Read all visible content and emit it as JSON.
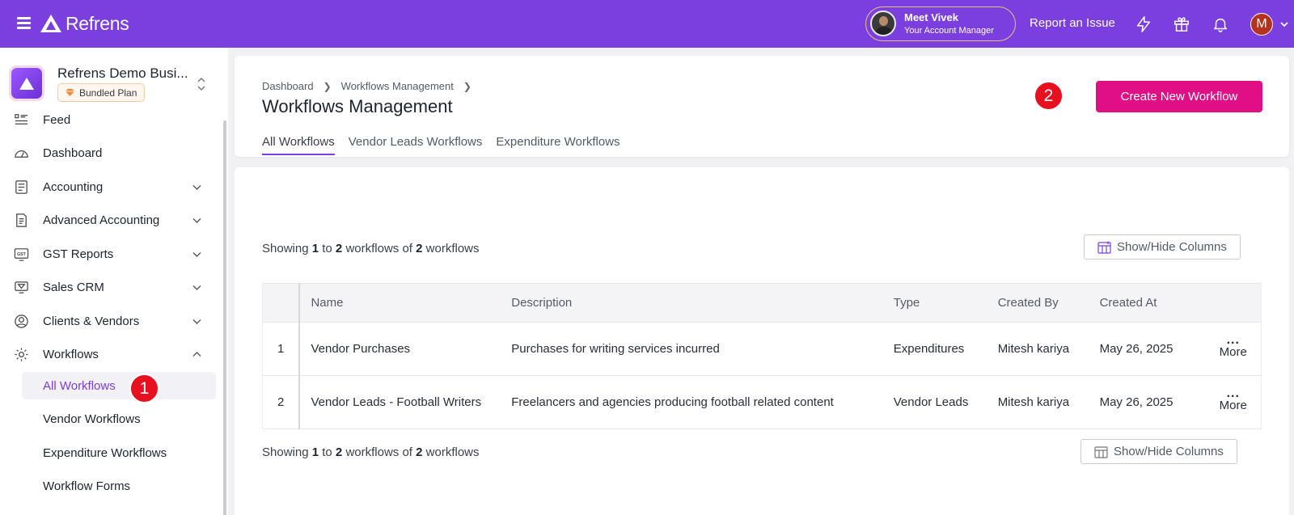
{
  "topbar": {
    "brand": "Refrens",
    "account_manager": {
      "name": "Meet Vivek",
      "subtitle": "Your Account Manager"
    },
    "report_issue": "Report an Issue",
    "user_initial": "M",
    "icons": [
      "menu-icon",
      "bolt-icon",
      "gift-icon",
      "bell-icon",
      "chevron-down-icon"
    ],
    "accent": "#7b3fe0"
  },
  "sidebar": {
    "business_name": "Refrens Demo Busi...",
    "plan": "Bundled Plan",
    "items": [
      {
        "label": "Feed",
        "icon": "feed-icon"
      },
      {
        "label": "Dashboard",
        "icon": "dashboard-icon"
      },
      {
        "label": "Accounting",
        "icon": "ledger-icon"
      },
      {
        "label": "Advanced Accounting",
        "icon": "document-icon"
      },
      {
        "label": "GST Reports",
        "icon": "gst-icon"
      },
      {
        "label": "Sales CRM",
        "icon": "crm-icon"
      },
      {
        "label": "Clients & Vendors",
        "icon": "user-circle-icon"
      },
      {
        "label": "Workflows",
        "icon": "workflow-gear-icon"
      }
    ],
    "subitems": [
      {
        "label": "All Workflows",
        "active": true
      },
      {
        "label": "Vendor Workflows"
      },
      {
        "label": "Expenditure Workflows"
      },
      {
        "label": "Workflow Forms"
      }
    ],
    "marker_1": "1"
  },
  "header": {
    "breadcrumbs": [
      "Dashboard",
      "Workflows Management"
    ],
    "title": "Workflows Management",
    "tabs": [
      "All Workflows",
      "Vendor Leads Workflows",
      "Expenditure Workflows"
    ],
    "create_button": "Create New Workflow",
    "brand_pink": "#e10f85",
    "marker_2": "2"
  },
  "listing": {
    "showing_prefix": "Showing",
    "from": "1",
    "to_word": "to",
    "to": "2",
    "unit": "workflows",
    "of_word": "of",
    "total": "2",
    "showhide_label": "Show/Hide Columns",
    "columns": [
      "",
      "Name",
      "Description",
      "Type",
      "Created By",
      "Created At",
      ""
    ],
    "rows": [
      {
        "idx": "1",
        "name": "Vendor Purchases",
        "description": "Purchases for writing services incurred",
        "type": "Expenditures",
        "created_by": "Mitesh kariya",
        "created_at": "May 26, 2025",
        "more_dots": "...",
        "more": "More"
      },
      {
        "idx": "2",
        "name": "Vendor Leads - Football Writers",
        "description": "Freelancers and agencies producing football related content",
        "type": "Vendor Leads",
        "created_by": "Mitesh kariya",
        "created_at": "May 26, 2025",
        "more_dots": "...",
        "more": "More"
      }
    ]
  }
}
